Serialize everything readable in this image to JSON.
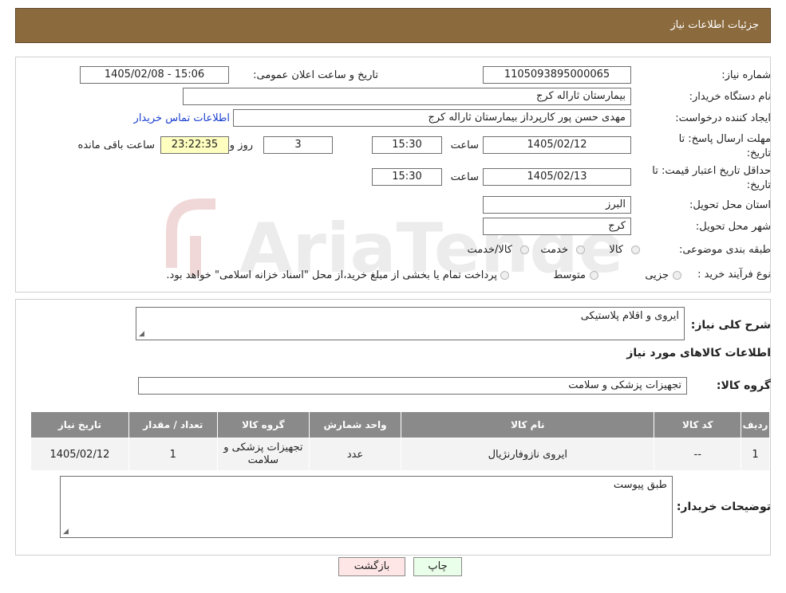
{
  "header": {
    "title": "جزئیات اطلاعات نیاز"
  },
  "watermark": {
    "text": "AriaTender.neT"
  },
  "form": {
    "need_number_label": "شماره نیاز:",
    "need_number": "1105093895000065",
    "announce_label": "تاریخ و ساعت اعلان عمومی:",
    "announce_value": "1405/02/08 - 15:06",
    "buyer_org_label": "نام دستگاه خریدار:",
    "buyer_org": "بیمارستان ثاراله کرج",
    "creator_label": "ایجاد کننده درخواست:",
    "creator": "مهدی حسن پور کارپرداز بیمارستان ثاراله کرج",
    "contact_link": "اطلاعات تماس خریدار",
    "deadline_label": "مهلت ارسال پاسخ: تا تاریخ:",
    "deadline_date": "1405/02/12",
    "time_label": "ساعت",
    "deadline_time": "15:30",
    "days_value": "3",
    "days_label": "روز و",
    "remaining_time": "23:22:35",
    "remaining_label": "ساعت باقی مانده",
    "validity_label": "حداقل تاریخ اعتبار قیمت: تا تاریخ:",
    "validity_date": "1405/02/13",
    "validity_time": "15:30",
    "province_label": "استان محل تحویل:",
    "province": "البرز",
    "city_label": "شهر محل تحویل:",
    "city": "کرج",
    "category_label": "طبقه بندی موضوعی:",
    "category_options": [
      "کالا",
      "خدمت",
      "کالا/خدمت"
    ],
    "process_label": "نوع فرآیند خرید :",
    "process_options": [
      "جزیی",
      "متوسط"
    ],
    "process_note": "پرداخت تمام یا بخشی از مبلغ خرید،از محل \"اسناد خزانه اسلامی\" خواهد بود."
  },
  "summary": {
    "label": "شرح کلی نیاز:",
    "value": "ایروی و اقلام پلاستیکی",
    "goods_info_title": "اطلاعات کالاهای مورد نیاز",
    "group_label": "گروه کالا:",
    "group_value": "تجهیزات پزشکی و سلامت"
  },
  "table": {
    "headers": [
      "ردیف",
      "کد کالا",
      "نام کالا",
      "واحد شمارش",
      "گروه کالا",
      "تعداد / مقدار",
      "تاریخ نیاز"
    ],
    "rows": [
      [
        "1",
        "--",
        "ایروی نازوفارنژیال",
        "عدد",
        "تجهیزات پزشکی و سلامت",
        "1",
        "1405/02/12"
      ]
    ]
  },
  "buyer_notes": {
    "label": "توضیحات خریدار:",
    "value": "طبق پیوست"
  },
  "buttons": {
    "print": "چاپ",
    "back": "بازگشت"
  }
}
